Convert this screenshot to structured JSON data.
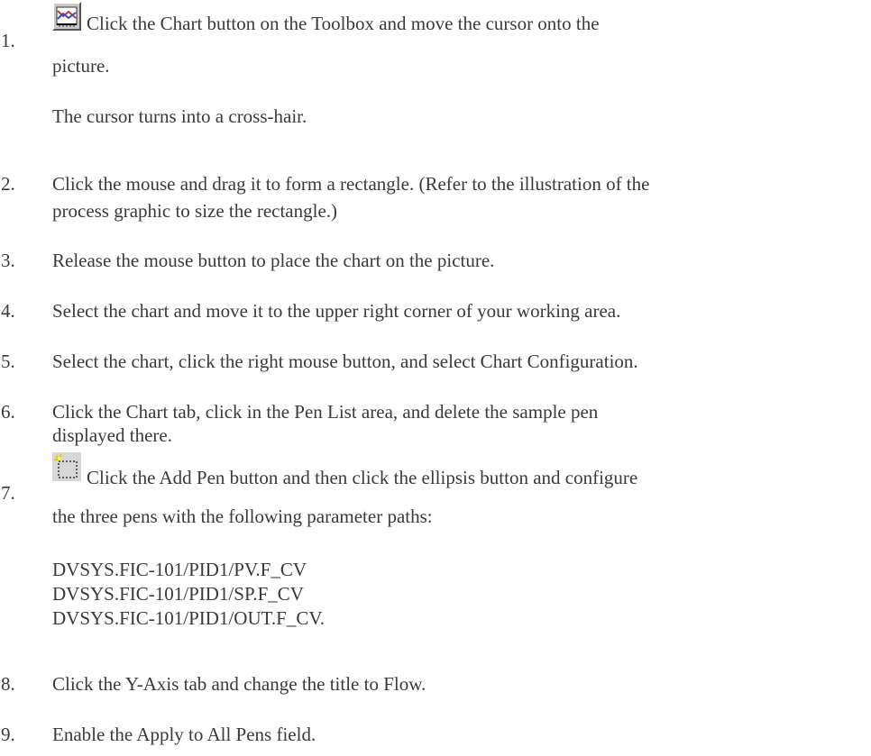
{
  "steps": [
    {
      "num": "1.",
      "text": "Click the Chart button on the Toolbox and move the cursor onto the",
      "cont": "picture.",
      "sub": "The cursor turns into a cross-hair.",
      "icon": "chart-button-icon"
    },
    {
      "num": "2.",
      "line1": "Click the mouse and drag it to form a rectangle. (Refer to the illustration of the",
      "line2": "process graphic to size the rectangle.)"
    },
    {
      "num": "3.",
      "text": "Release the mouse button to place the chart on the picture."
    },
    {
      "num": "4.",
      "text": "Select the chart and move it to the upper right corner of your working area."
    },
    {
      "num": "5.",
      "text": "Select the chart, click the right mouse button, and select Chart Configuration."
    },
    {
      "num": "6.",
      "line1": "Click the Chart tab, click in the Pen List area, and delete the sample pen",
      "line2": "displayed there."
    },
    {
      "num": "7.",
      "text": "Click the Add Pen button and then click the ellipsis button and configure",
      "cont": "the three pens with the following parameter paths:",
      "paths": [
        "DVSYS.FIC-101/PID1/PV.F_CV",
        "DVSYS.FIC-101/PID1/SP.F_CV",
        "DVSYS.FIC-101/PID1/OUT.F_CV."
      ],
      "icon": "add-pen-button-icon"
    },
    {
      "num": "8.",
      "text": "Click the Y-Axis tab and change the title to Flow."
    },
    {
      "num": "9.",
      "text": "Enable the Apply to All Pens field."
    }
  ]
}
